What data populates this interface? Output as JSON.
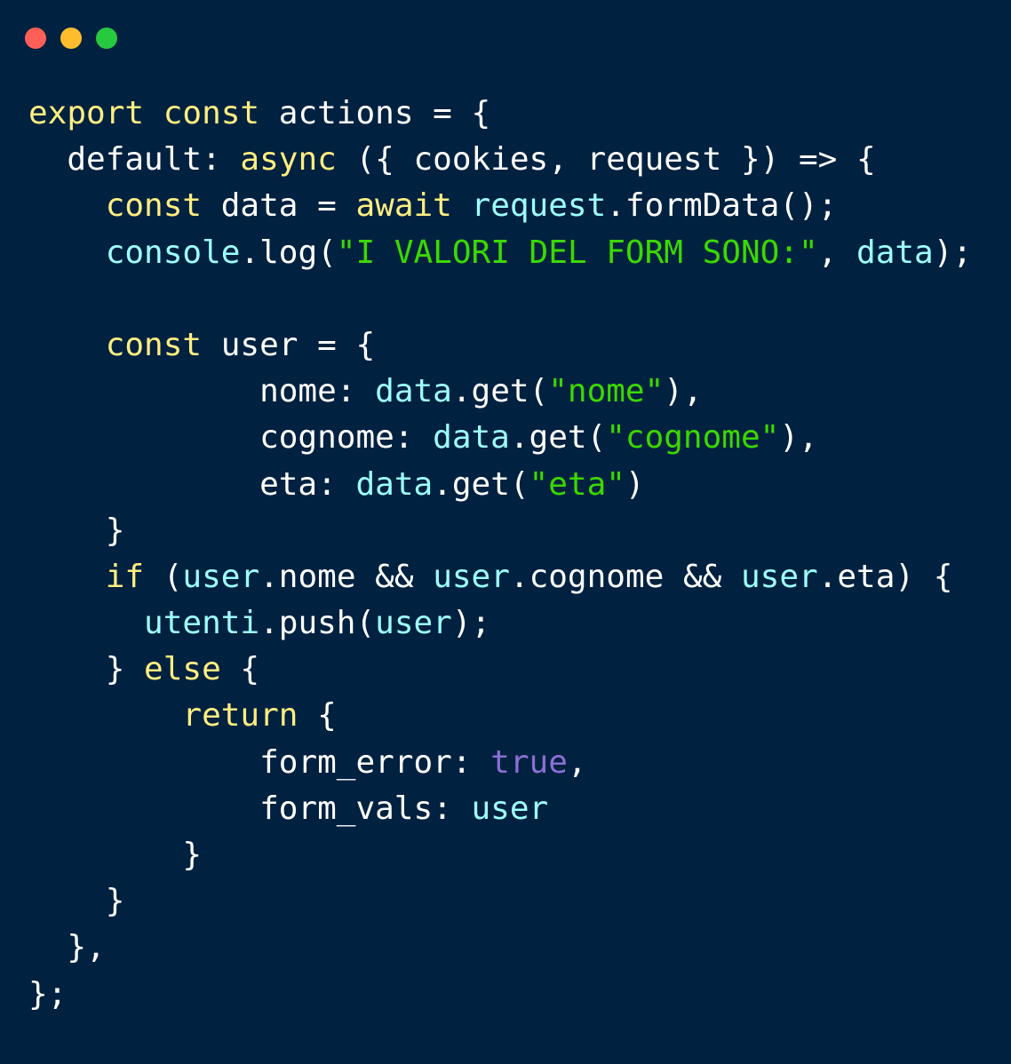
{
  "window": {
    "controls": [
      {
        "name": "close",
        "color": "#ff5f56"
      },
      {
        "name": "minimize",
        "color": "#ffbd2e"
      },
      {
        "name": "maximize",
        "color": "#27c93f"
      }
    ]
  },
  "theme": {
    "background": "#002140",
    "keyword": "#ffee80",
    "identifier": "#9effff",
    "string": "#3ad900",
    "constant": "#8a6fd1",
    "plain": "#ffffff"
  },
  "code": {
    "lines": [
      [
        [
          "kw",
          "export"
        ],
        [
          "pl",
          " "
        ],
        [
          "kw",
          "const"
        ],
        [
          "pl",
          " actions = {"
        ]
      ],
      [
        [
          "pl",
          "  default: "
        ],
        [
          "kw",
          "async"
        ],
        [
          "pl",
          " ({ cookies, request }) => {"
        ]
      ],
      [
        [
          "pl",
          "    "
        ],
        [
          "kw",
          "const"
        ],
        [
          "pl",
          " data = "
        ],
        [
          "kw",
          "await"
        ],
        [
          "pl",
          " "
        ],
        [
          "var",
          "request"
        ],
        [
          "pl",
          ".formData();"
        ]
      ],
      [
        [
          "pl",
          "    "
        ],
        [
          "var",
          "console"
        ],
        [
          "pl",
          ".log("
        ],
        [
          "str",
          "\"I VALORI DEL FORM SONO:\""
        ],
        [
          "pl",
          ", "
        ],
        [
          "var",
          "data"
        ],
        [
          "pl",
          ");"
        ]
      ],
      [
        [
          "pl",
          ""
        ]
      ],
      [
        [
          "pl",
          "    "
        ],
        [
          "kw",
          "const"
        ],
        [
          "pl",
          " user = {"
        ]
      ],
      [
        [
          "pl",
          "            nome: "
        ],
        [
          "var",
          "data"
        ],
        [
          "pl",
          ".get("
        ],
        [
          "str",
          "\"nome\""
        ],
        [
          "pl",
          "),"
        ]
      ],
      [
        [
          "pl",
          "            cognome: "
        ],
        [
          "var",
          "data"
        ],
        [
          "pl",
          ".get("
        ],
        [
          "str",
          "\"cognome\""
        ],
        [
          "pl",
          "),"
        ]
      ],
      [
        [
          "pl",
          "            eta: "
        ],
        [
          "var",
          "data"
        ],
        [
          "pl",
          ".get("
        ],
        [
          "str",
          "\"eta\""
        ],
        [
          "pl",
          ")"
        ]
      ],
      [
        [
          "pl",
          "    }"
        ]
      ],
      [
        [
          "pl",
          "    "
        ],
        [
          "kw",
          "if"
        ],
        [
          "pl",
          " ("
        ],
        [
          "var",
          "user"
        ],
        [
          "pl",
          ".nome && "
        ],
        [
          "var",
          "user"
        ],
        [
          "pl",
          ".cognome && "
        ],
        [
          "var",
          "user"
        ],
        [
          "pl",
          ".eta) {"
        ]
      ],
      [
        [
          "pl",
          "      "
        ],
        [
          "var",
          "utenti"
        ],
        [
          "pl",
          ".push("
        ],
        [
          "var",
          "user"
        ],
        [
          "pl",
          ");"
        ]
      ],
      [
        [
          "pl",
          "    } "
        ],
        [
          "kw",
          "else"
        ],
        [
          "pl",
          " {"
        ]
      ],
      [
        [
          "pl",
          "        "
        ],
        [
          "kw",
          "return"
        ],
        [
          "pl",
          " {"
        ]
      ],
      [
        [
          "pl",
          "            form_error: "
        ],
        [
          "con",
          "true"
        ],
        [
          "pl",
          ","
        ]
      ],
      [
        [
          "pl",
          "            form_vals: "
        ],
        [
          "var",
          "user"
        ]
      ],
      [
        [
          "pl",
          "        }"
        ]
      ],
      [
        [
          "pl",
          "    }"
        ]
      ],
      [
        [
          "pl",
          "  },"
        ]
      ],
      [
        [
          "pl",
          "};"
        ]
      ]
    ]
  }
}
